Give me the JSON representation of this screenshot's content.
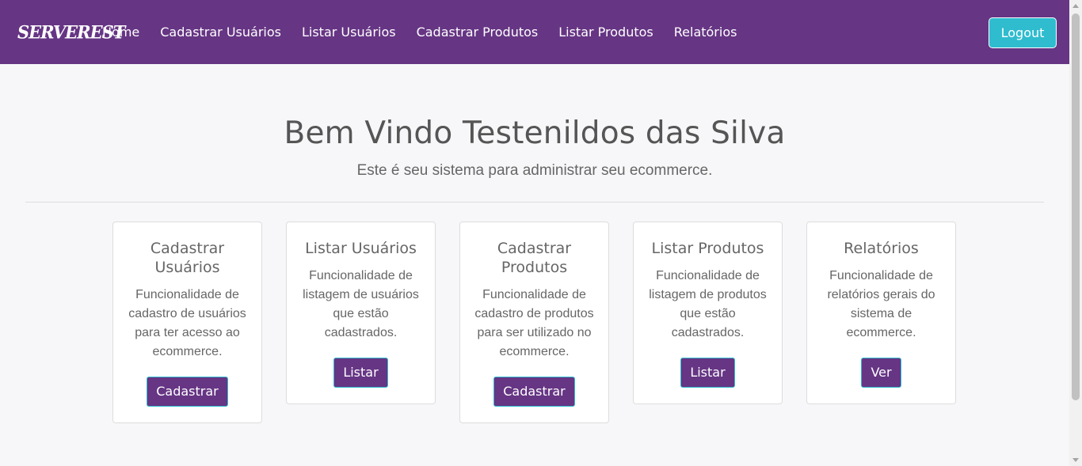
{
  "navbar": {
    "brand": "SERVEREST",
    "links": [
      "Home",
      "Cadastrar Usuários",
      "Listar Usuários",
      "Cadastrar Produtos",
      "Listar Produtos",
      "Relatórios"
    ],
    "logout": "Logout"
  },
  "hero": {
    "title": "Bem Vindo Testenildos das Silva",
    "subtitle": "Este é seu sistema para administrar seu ecommerce."
  },
  "cards": [
    {
      "title": "Cadastrar Usuários",
      "text": "Funcionalidade de cadastro de usuários para ter acesso ao ecommerce.",
      "button": "Cadastrar"
    },
    {
      "title": "Listar Usuários",
      "text": "Funcionalidade de listagem de usuários que estão cadastrados.",
      "button": "Listar"
    },
    {
      "title": "Cadastrar Produtos",
      "text": "Funcionalidade de cadastro de produtos para ser utilizado no ecommerce.",
      "button": "Cadastrar"
    },
    {
      "title": "Listar Produtos",
      "text": "Funcionalidade de listagem de produtos que estão cadastrados.",
      "button": "Listar"
    },
    {
      "title": "Relatórios",
      "text": "Funcionalidade de relatórios gerais do sistema de ecommerce.",
      "button": "Ver"
    }
  ],
  "colors": {
    "primary": "#663584",
    "accent": "#2fbccf",
    "background": "#f7f7f9"
  }
}
